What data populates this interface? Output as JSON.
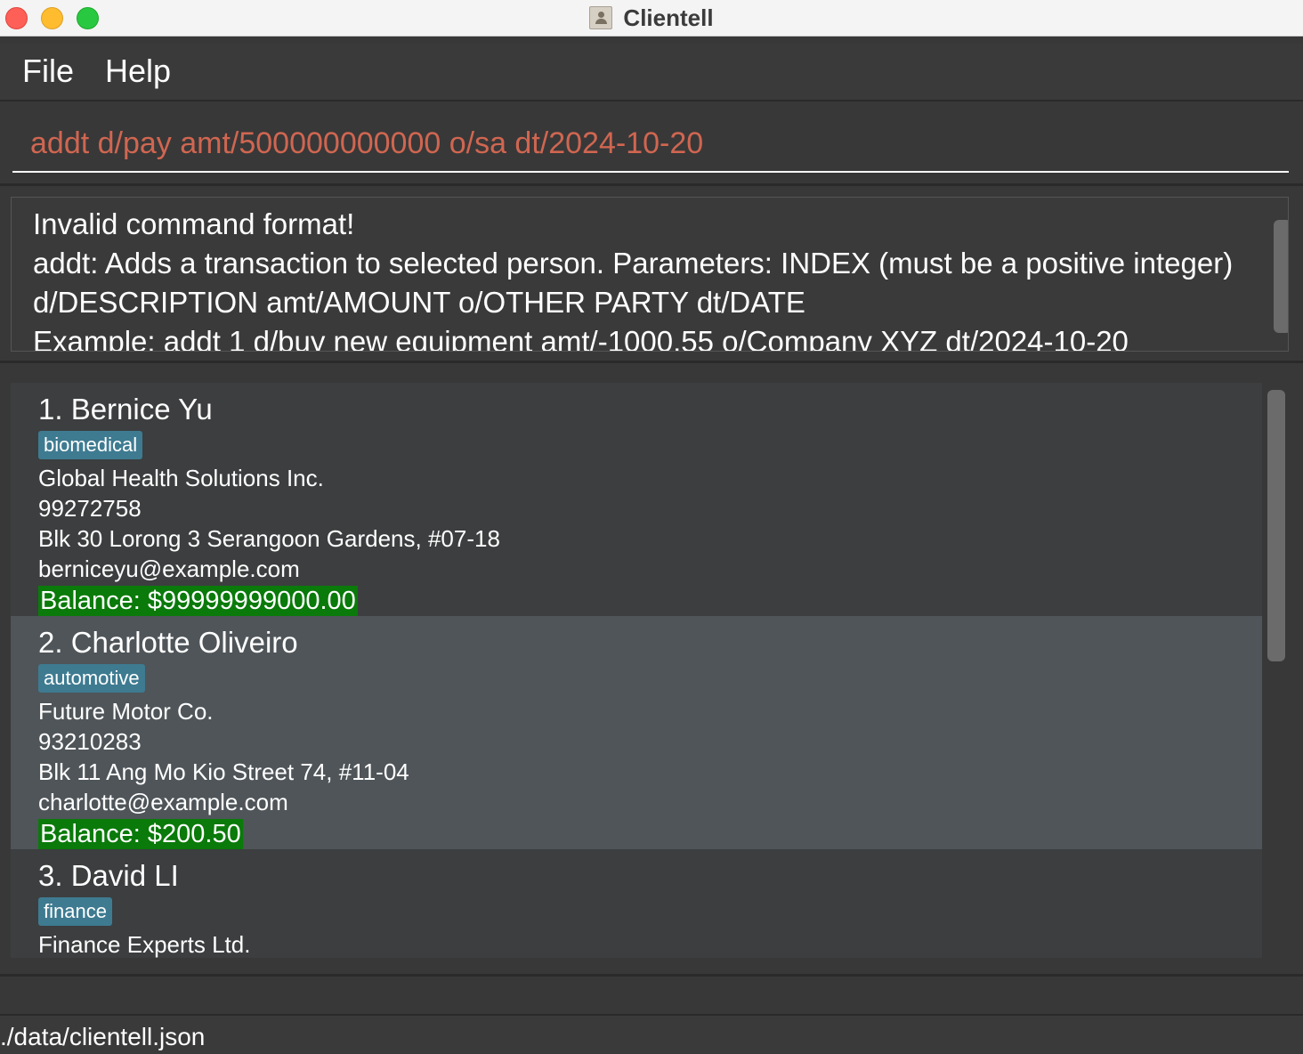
{
  "window": {
    "title": "Clientell"
  },
  "menu": {
    "items": [
      "File",
      "Help"
    ]
  },
  "command_box": {
    "value": "addt d/pay amt/500000000000 o/sa dt/2024-10-20"
  },
  "result_display": {
    "text": "Invalid command format!\naddt: Adds a transaction to selected person. Parameters: INDEX (must be a positive integer) d/DESCRIPTION amt/AMOUNT o/OTHER PARTY dt/DATE\nExample: addt 1 d/buy new equipment amt/-1000.55 o/Company XYZ dt/2024-10-20"
  },
  "persons": [
    {
      "name": "1. Bernice Yu",
      "tag": "biomedical",
      "company": "Global Health Solutions Inc.",
      "phone": "99272758",
      "address": "Blk 30 Lorong 3 Serangoon Gardens, #07-18",
      "email": "berniceyu@example.com",
      "balance": "Balance: $99999999000.00",
      "selected": false
    },
    {
      "name": "2. Charlotte Oliveiro",
      "tag": "automotive",
      "company": "Future Motor Co.",
      "phone": "93210283",
      "address": "Blk 11 Ang Mo Kio Street 74, #11-04",
      "email": "charlotte@example.com",
      "balance": "Balance: $200.50",
      "selected": true
    },
    {
      "name": "3. David LI",
      "tag": "finance",
      "company": "Finance Experts Ltd.",
      "selected": false
    }
  ],
  "status_bar": {
    "path": "./data/clientell.json"
  },
  "colors": {
    "command_text": "#d06651",
    "tag_bg": "#3e7b91",
    "balance_bg": "#0a7a0a",
    "selected_card": "#4f5559"
  }
}
